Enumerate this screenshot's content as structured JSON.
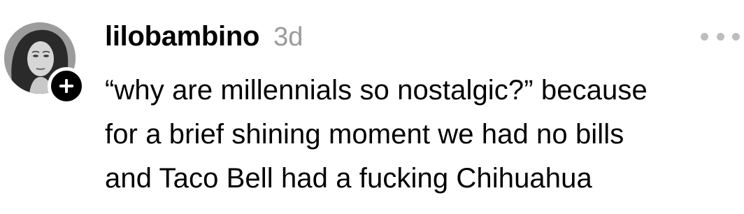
{
  "post": {
    "username": "lilobambino",
    "timestamp": "3d",
    "body_lines": [
      "“why are millennials so nostalgic?” because",
      "for a brief shining moment we had no bills",
      "and Taco Bell had a fucking Chihuahua"
    ],
    "icons": {
      "avatar": "profile-photo",
      "follow": "plus-icon",
      "more": "ellipsis-icon"
    }
  }
}
